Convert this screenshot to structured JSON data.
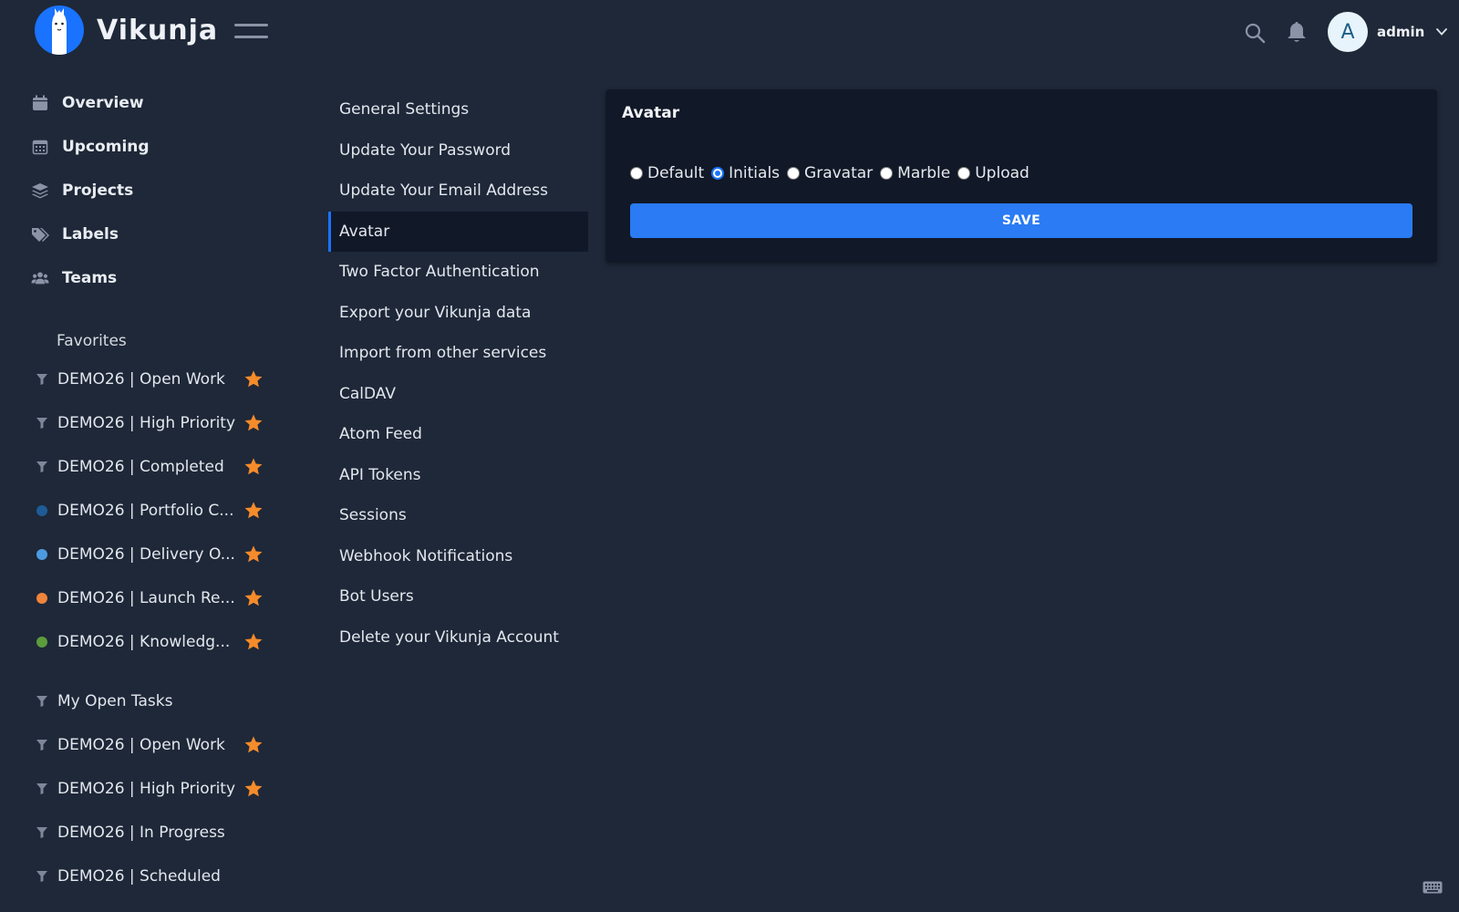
{
  "app": {
    "name": "Vikunja"
  },
  "header": {
    "username": "admin",
    "avatar_initial": "A"
  },
  "sidebar": {
    "nav": [
      {
        "label": "Overview",
        "icon": "calendar-icon"
      },
      {
        "label": "Upcoming",
        "icon": "calendar-grid-icon"
      },
      {
        "label": "Projects",
        "icon": "layers-icon"
      },
      {
        "label": "Labels",
        "icon": "tags-icon"
      },
      {
        "label": "Teams",
        "icon": "users-icon"
      }
    ],
    "favorites_title": "Favorites",
    "favorites": [
      {
        "name": "DEMO26 | Open Work",
        "marker": "filter",
        "starred": true
      },
      {
        "name": "DEMO26 | High Priority",
        "marker": "filter",
        "starred": true
      },
      {
        "name": "DEMO26 | Completed",
        "marker": "filter",
        "starred": true
      },
      {
        "name": "DEMO26 | Portfolio C...",
        "marker": "dot",
        "color": "#1e5b97",
        "starred": true
      },
      {
        "name": "DEMO26 | Delivery O...",
        "marker": "dot",
        "color": "#4c9be0",
        "starred": true
      },
      {
        "name": "DEMO26 | Launch Re...",
        "marker": "dot",
        "color": "#f0843a",
        "starred": true
      },
      {
        "name": "DEMO26 | Knowledg...",
        "marker": "dot",
        "color": "#5c9c3c",
        "starred": true
      }
    ],
    "projects": [
      {
        "name": "My Open Tasks",
        "marker": "filter",
        "starred": false
      },
      {
        "name": "DEMO26 | Open Work",
        "marker": "filter",
        "starred": true
      },
      {
        "name": "DEMO26 | High Priority",
        "marker": "filter",
        "starred": true
      },
      {
        "name": "DEMO26 | In Progress",
        "marker": "filter",
        "starred": false
      },
      {
        "name": "DEMO26 | Scheduled",
        "marker": "filter",
        "starred": false
      }
    ]
  },
  "settings_nav": [
    {
      "label": "General Settings",
      "active": false
    },
    {
      "label": "Update Your Password",
      "active": false
    },
    {
      "label": "Update Your Email Address",
      "active": false
    },
    {
      "label": "Avatar",
      "active": true
    },
    {
      "label": "Two Factor Authentication",
      "active": false
    },
    {
      "label": "Export your Vikunja data",
      "active": false
    },
    {
      "label": "Import from other services",
      "active": false
    },
    {
      "label": "CalDAV",
      "active": false
    },
    {
      "label": "Atom Feed",
      "active": false
    },
    {
      "label": "API Tokens",
      "active": false
    },
    {
      "label": "Sessions",
      "active": false
    },
    {
      "label": "Webhook Notifications",
      "active": false
    },
    {
      "label": "Bot Users",
      "active": false
    },
    {
      "label": "Delete your Vikunja Account",
      "active": false
    }
  ],
  "avatar_card": {
    "title": "Avatar",
    "options": [
      {
        "label": "Default",
        "selected": false
      },
      {
        "label": "Initials",
        "selected": true
      },
      {
        "label": "Gravatar",
        "selected": false
      },
      {
        "label": "Marble",
        "selected": false
      },
      {
        "label": "Upload",
        "selected": false
      }
    ],
    "save_label": "SAVE"
  },
  "colors": {
    "background": "#1e2838",
    "card": "#111827",
    "primary": "#2a7bf4",
    "star": "#f68b2a"
  }
}
